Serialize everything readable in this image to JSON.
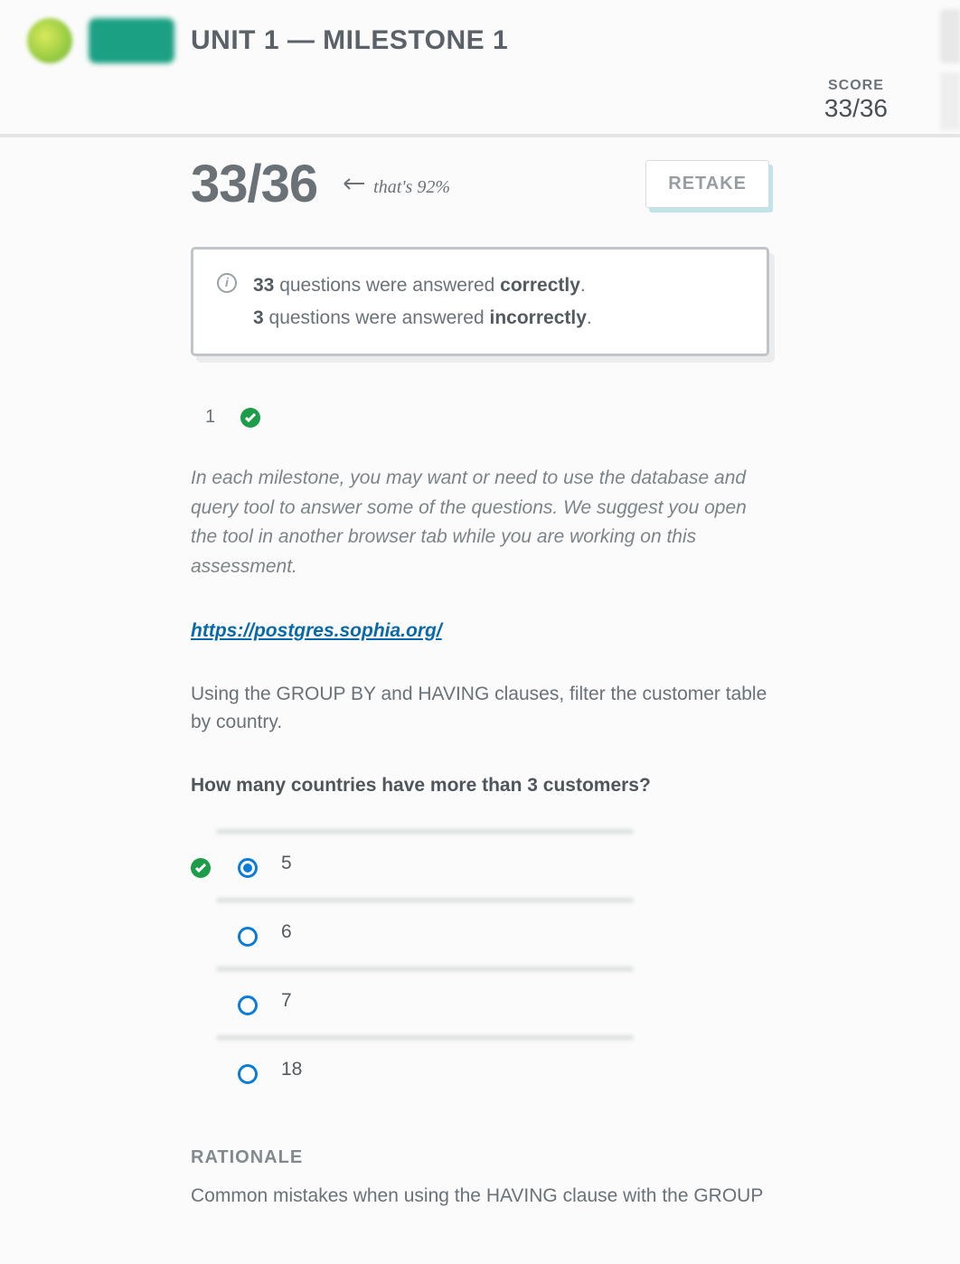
{
  "header": {
    "title": "UNIT 1 — MILESTONE 1",
    "score_label": "SCORE",
    "score_value": "33/36"
  },
  "summary": {
    "big_score": "33/36",
    "thats": "that's 92%",
    "retake": "RETAKE",
    "line1_count": "33",
    "line1_mid": " questions were answered ",
    "line1_bold": "correctly",
    "line1_end": ".",
    "line2_count": "3",
    "line2_mid": " questions were answered ",
    "line2_bold": "incorrectly",
    "line2_end": "."
  },
  "question": {
    "number": "1",
    "intro": "In each milestone, you may want or need to use the database and query tool to answer some of the questions. We suggest you open the tool in another browser tab while you are working on this assessment.",
    "link": "https://postgres.sophia.org/",
    "instruction": "Using the GROUP BY and HAVING clauses, filter the customer table by country.",
    "prompt": "How many countries have more than 3 customers?",
    "options": [
      {
        "text": "5",
        "selected": true,
        "correct": true
      },
      {
        "text": "6",
        "selected": false,
        "correct": false
      },
      {
        "text": "7",
        "selected": false,
        "correct": false
      },
      {
        "text": "18",
        "selected": false,
        "correct": false
      }
    ],
    "rationale_h": "RATIONALE",
    "rationale_p": "Common mistakes when using the HAVING clause with the GROUP"
  }
}
